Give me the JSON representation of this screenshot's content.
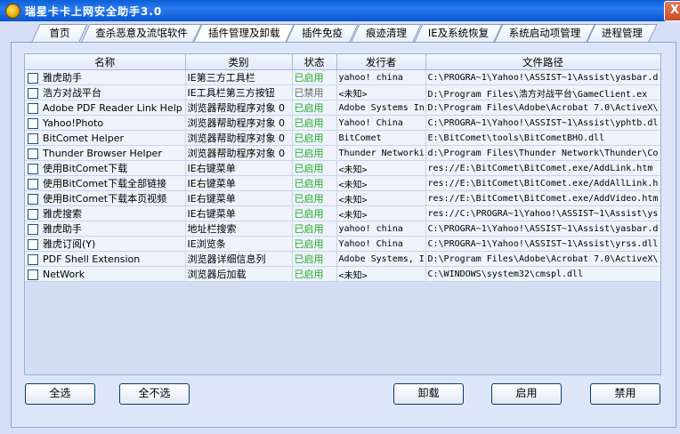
{
  "window": {
    "title": "瑞星卡卡上网安全助手3.0",
    "close_symbol": "X"
  },
  "tabs": [
    {
      "label": "首页"
    },
    {
      "label": "查杀恶意及流氓软件"
    },
    {
      "label": "插件管理及卸载",
      "active": true
    },
    {
      "label": "插件免疫"
    },
    {
      "label": "痕迹清理"
    },
    {
      "label": "IE及系统恢复"
    },
    {
      "label": "系统启动项管理"
    },
    {
      "label": "进程管理"
    }
  ],
  "table": {
    "columns": [
      "名称",
      "类别",
      "状态",
      "发行者",
      "文件路径"
    ],
    "rows": [
      {
        "name": "雅虎助手",
        "category": "IE第三方工具栏",
        "status": "已启用",
        "publisher": "yahoo! china",
        "path": "C:\\PROGRA~1\\Yahoo!\\ASSIST~1\\Assist\\yasbar.d"
      },
      {
        "name": "浩方对战平台",
        "category": "IE工具栏第三方按钮",
        "status": "已禁用",
        "publisher": "<未知>",
        "path": "D:\\Program Files\\浩方对战平台\\GameClient.ex"
      },
      {
        "name": "Adobe PDF Reader Link Help",
        "category": "浏览器帮助程序对象 0",
        "status": "已启用",
        "publisher": "Adobe Systems In",
        "path": "D:\\Program Files\\Adobe\\Acrobat 7.0\\ActiveX\\"
      },
      {
        "name": "Yahoo!Photo",
        "category": "浏览器帮助程序对象 0",
        "status": "已启用",
        "publisher": "Yahoo! China",
        "path": "C:\\PROGRA~1\\Yahoo!\\ASSIST~1\\Assist\\yphtb.dl"
      },
      {
        "name": "BitComet Helper",
        "category": "浏览器帮助程序对象 0",
        "status": "已启用",
        "publisher": "BitComet",
        "path": "E:\\BitComet\\tools\\BitCometBHO.dll"
      },
      {
        "name": "Thunder Browser Helper",
        "category": "浏览器帮助程序对象 0",
        "status": "已启用",
        "publisher": "Thunder Networki",
        "path": "d:\\Program Files\\Thunder Network\\Thunder\\Co"
      },
      {
        "name": "使用BitComet下载",
        "category": "IE右键菜单",
        "status": "已启用",
        "publisher": "<未知>",
        "path": "res://E:\\BitComet\\BitComet.exe/AddLink.htm"
      },
      {
        "name": "使用BitComet下载全部链接",
        "category": "IE右键菜单",
        "status": "已启用",
        "publisher": "<未知>",
        "path": "res://E:\\BitComet\\BitComet.exe/AddAllLink.h"
      },
      {
        "name": "使用BitComet下载本页视频",
        "category": "IE右键菜单",
        "status": "已启用",
        "publisher": "<未知>",
        "path": "res://E:\\BitComet\\BitComet.exe/AddVideo.htm"
      },
      {
        "name": "雅虎搜索",
        "category": "IE右键菜单",
        "status": "已启用",
        "publisher": "<未知>",
        "path": "res://C:\\PROGRA~1\\Yahoo!\\ASSIST~1\\Assist\\ys"
      },
      {
        "name": "雅虎助手",
        "category": "地址栏搜索",
        "status": "已启用",
        "publisher": "yahoo! china",
        "path": "C:\\PROGRA~1\\Yahoo!\\ASSIST~1\\Assist\\yasbar.d"
      },
      {
        "name": "雅虎订阅(Y)",
        "category": "IE浏览条",
        "status": "已启用",
        "publisher": "Yahoo! China",
        "path": "C:\\PROGRA~1\\Yahoo!\\ASSIST~1\\Assist\\yrss.dll"
      },
      {
        "name": "PDF Shell Extension",
        "category": "浏览器详细信息列",
        "status": "已启用",
        "publisher": "Adobe Systems, I",
        "path": "D:\\Program Files\\Adobe\\Acrobat 7.0\\ActiveX\\"
      },
      {
        "name": "NetWork",
        "category": "浏览器后加载",
        "status": "已启用",
        "publisher": "<未知>",
        "path": "C:\\WINDOWS\\system32\\cmspl.dll"
      }
    ]
  },
  "buttons": {
    "select_all": "全选",
    "select_none": "全不选",
    "uninstall": "卸载",
    "enable": "启用",
    "disable": "禁用"
  },
  "colors": {
    "enabled": "#22aa22",
    "disabled": "#6a6a6a",
    "title_bar": "#0a5fd8"
  }
}
